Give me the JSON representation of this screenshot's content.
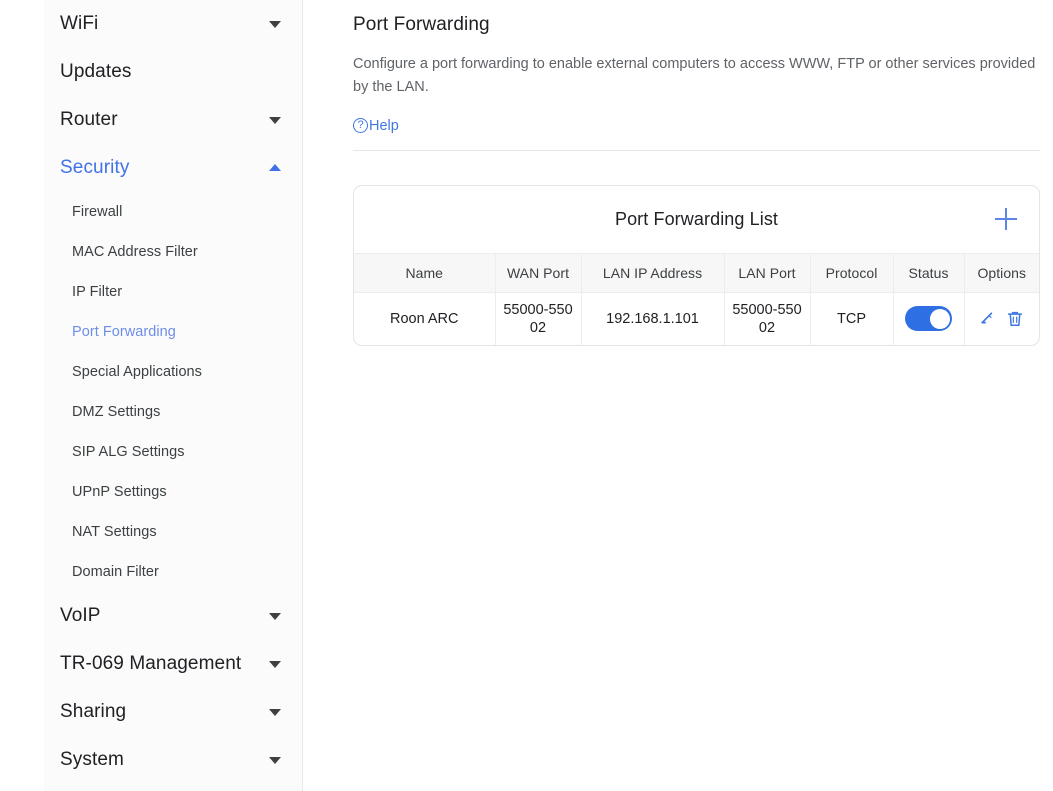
{
  "sidebar": {
    "items": [
      {
        "label": "WiFi",
        "type": "group",
        "icon": "chevron-down-icon",
        "expanded": false,
        "active": false
      },
      {
        "label": "Updates",
        "type": "group",
        "icon": "",
        "expanded": false,
        "active": false
      },
      {
        "label": "Router",
        "type": "group",
        "icon": "chevron-down-icon",
        "expanded": false,
        "active": false
      },
      {
        "label": "Security",
        "type": "group",
        "icon": "chevron-up-icon",
        "expanded": true,
        "active": true
      },
      {
        "label": "Firewall",
        "type": "sub",
        "active": false
      },
      {
        "label": "MAC Address Filter",
        "type": "sub",
        "active": false
      },
      {
        "label": "IP Filter",
        "type": "sub",
        "active": false
      },
      {
        "label": "Port Forwarding",
        "type": "sub",
        "active": true
      },
      {
        "label": "Special Applications",
        "type": "sub",
        "active": false
      },
      {
        "label": "DMZ Settings",
        "type": "sub",
        "active": false
      },
      {
        "label": "SIP ALG Settings",
        "type": "sub",
        "active": false
      },
      {
        "label": "UPnP Settings",
        "type": "sub",
        "active": false
      },
      {
        "label": "NAT Settings",
        "type": "sub",
        "active": false
      },
      {
        "label": "Domain Filter",
        "type": "sub",
        "active": false
      },
      {
        "label": "VoIP",
        "type": "group",
        "icon": "chevron-down-icon",
        "expanded": false,
        "active": false
      },
      {
        "label": "TR-069 Management",
        "type": "group",
        "icon": "chevron-down-icon",
        "expanded": false,
        "active": false
      },
      {
        "label": "Sharing",
        "type": "group",
        "icon": "chevron-down-icon",
        "expanded": false,
        "active": false
      },
      {
        "label": "System",
        "type": "group",
        "icon": "chevron-down-icon",
        "expanded": false,
        "active": false
      }
    ]
  },
  "main": {
    "title": "Port Forwarding",
    "description": "Configure a port forwarding to enable external computers to access WWW, FTP or other services provided by the LAN.",
    "help_label": "Help",
    "help_icon_glyph": "?",
    "card": {
      "title": "Port Forwarding List",
      "add_icon": "plus-icon",
      "columns": [
        "Name",
        "WAN Port",
        "LAN IP Address",
        "LAN Port",
        "Protocol",
        "Status",
        "Options"
      ],
      "rows": [
        {
          "name": "Roon ARC",
          "wan_port": "55000-55002",
          "lan_ip": "192.168.1.101",
          "lan_port": "55000-55002",
          "protocol": "TCP",
          "status_enabled": true,
          "options": [
            "edit-icon",
            "delete-icon"
          ]
        }
      ]
    }
  },
  "colors": {
    "accent": "#4071e8",
    "link": "#3f78e0",
    "toggle_on": "#2f6fe4",
    "sidebar_bg": "#fbfbfb",
    "header_bg": "#f7f7f7",
    "text": "#202124",
    "muted_text": "#5f6368"
  }
}
